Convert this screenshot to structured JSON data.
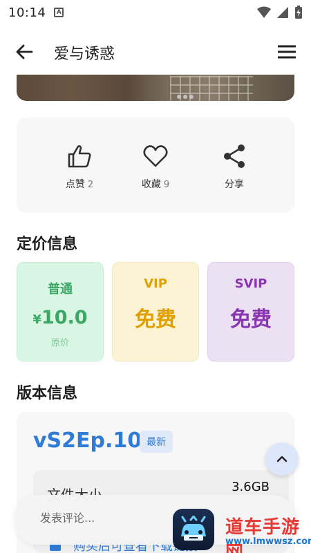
{
  "status_bar": {
    "time": "10:14",
    "notification_letter": "A"
  },
  "header": {
    "title": "爱与诱惑"
  },
  "actions": [
    {
      "label": "点赞",
      "count": "2",
      "icon": "thumbs-up-icon"
    },
    {
      "label": "收藏",
      "count": "9",
      "icon": "heart-icon"
    },
    {
      "label": "分享",
      "count": "",
      "icon": "share-icon"
    }
  ],
  "pricing": {
    "title": "定价信息",
    "normal": {
      "tier": "普通",
      "price": "10.0",
      "currency": "¥",
      "note": "原价"
    },
    "vip": {
      "tier": "VIP",
      "price": "免费"
    },
    "svip": {
      "tier": "SVIP",
      "price": "免费"
    }
  },
  "version": {
    "title": "版本信息",
    "name": "vS2Ep.10",
    "badge": "最新",
    "file_size_label": "文件大小",
    "file_size_value": "3.6GB",
    "buy_hint": "购买后可查看下载链接"
  },
  "comment": {
    "placeholder": "发表评论..."
  },
  "watermark": {
    "name": "道车手游网",
    "url": "www.lmwwsz.com"
  },
  "colors": {
    "accent_blue": "#2f7bd6",
    "green": "#3ba764",
    "gold": "#e0a000",
    "purple": "#8a36b0"
  }
}
